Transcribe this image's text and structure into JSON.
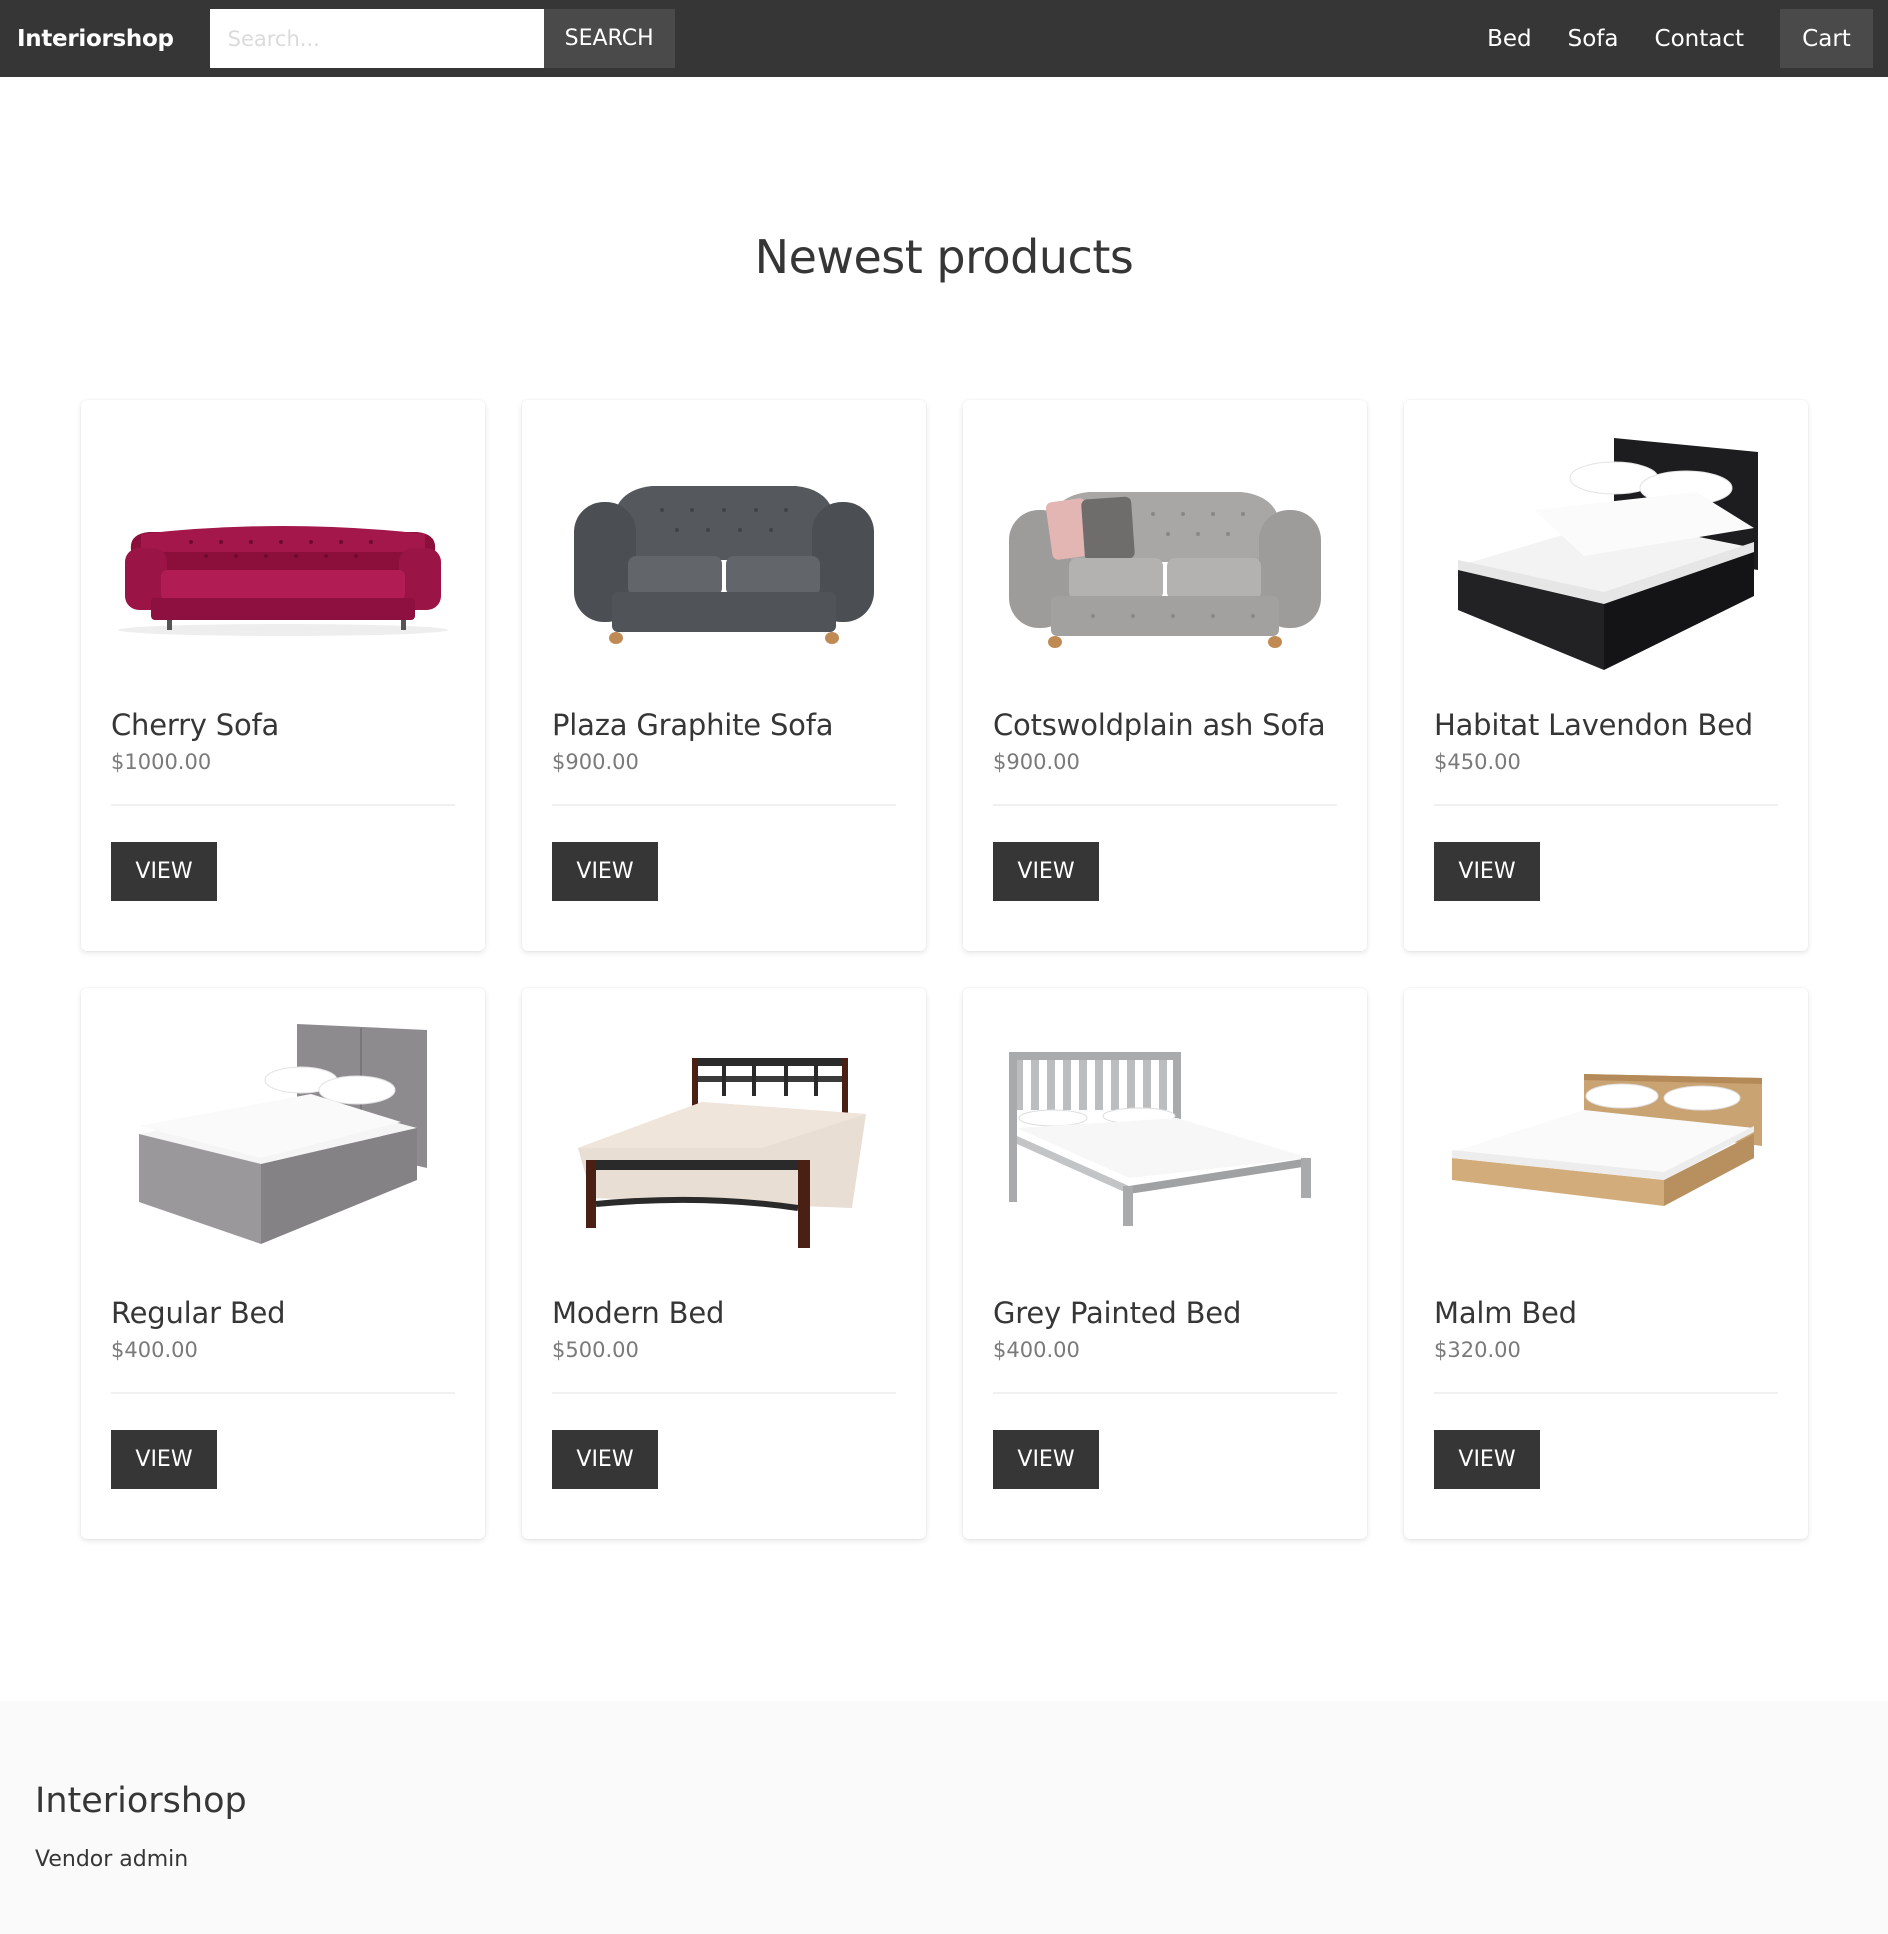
{
  "navbar": {
    "brand": "Interiorshop",
    "search_placeholder": "Search...",
    "search_button": "SEARCH",
    "links": [
      "Bed",
      "Sofa",
      "Contact"
    ],
    "cart": "Cart"
  },
  "main": {
    "title": "Newest products",
    "view_label": "VIEW",
    "products": [
      {
        "name": "Cherry Sofa",
        "price": "$1000.00",
        "image": "sofa-chesterfield-red"
      },
      {
        "name": "Plaza Graphite Sofa",
        "price": "$900.00",
        "image": "sofa-loveseat-graphite"
      },
      {
        "name": "Cotswoldplain ash Sofa",
        "price": "$900.00",
        "image": "sofa-loveseat-ash"
      },
      {
        "name": "Habitat Lavendon Bed",
        "price": "$450.00",
        "image": "bed-black-ottoman"
      },
      {
        "name": "Regular Bed",
        "price": "$400.00",
        "image": "bed-grey-upholstered"
      },
      {
        "name": "Modern Bed",
        "price": "$500.00",
        "image": "bed-metal-frame"
      },
      {
        "name": "Grey Painted Bed",
        "price": "$400.00",
        "image": "bed-grey-slatted"
      },
      {
        "name": "Malm Bed",
        "price": "$320.00",
        "image": "bed-oak-low"
      }
    ]
  },
  "footer": {
    "title": "Interiorshop",
    "link": "Vendor admin"
  },
  "colors": {
    "navbar_bg": "#363636",
    "button_bg": "#4a4a4a",
    "view_button_bg": "#363636",
    "footer_bg": "#fafafa"
  }
}
